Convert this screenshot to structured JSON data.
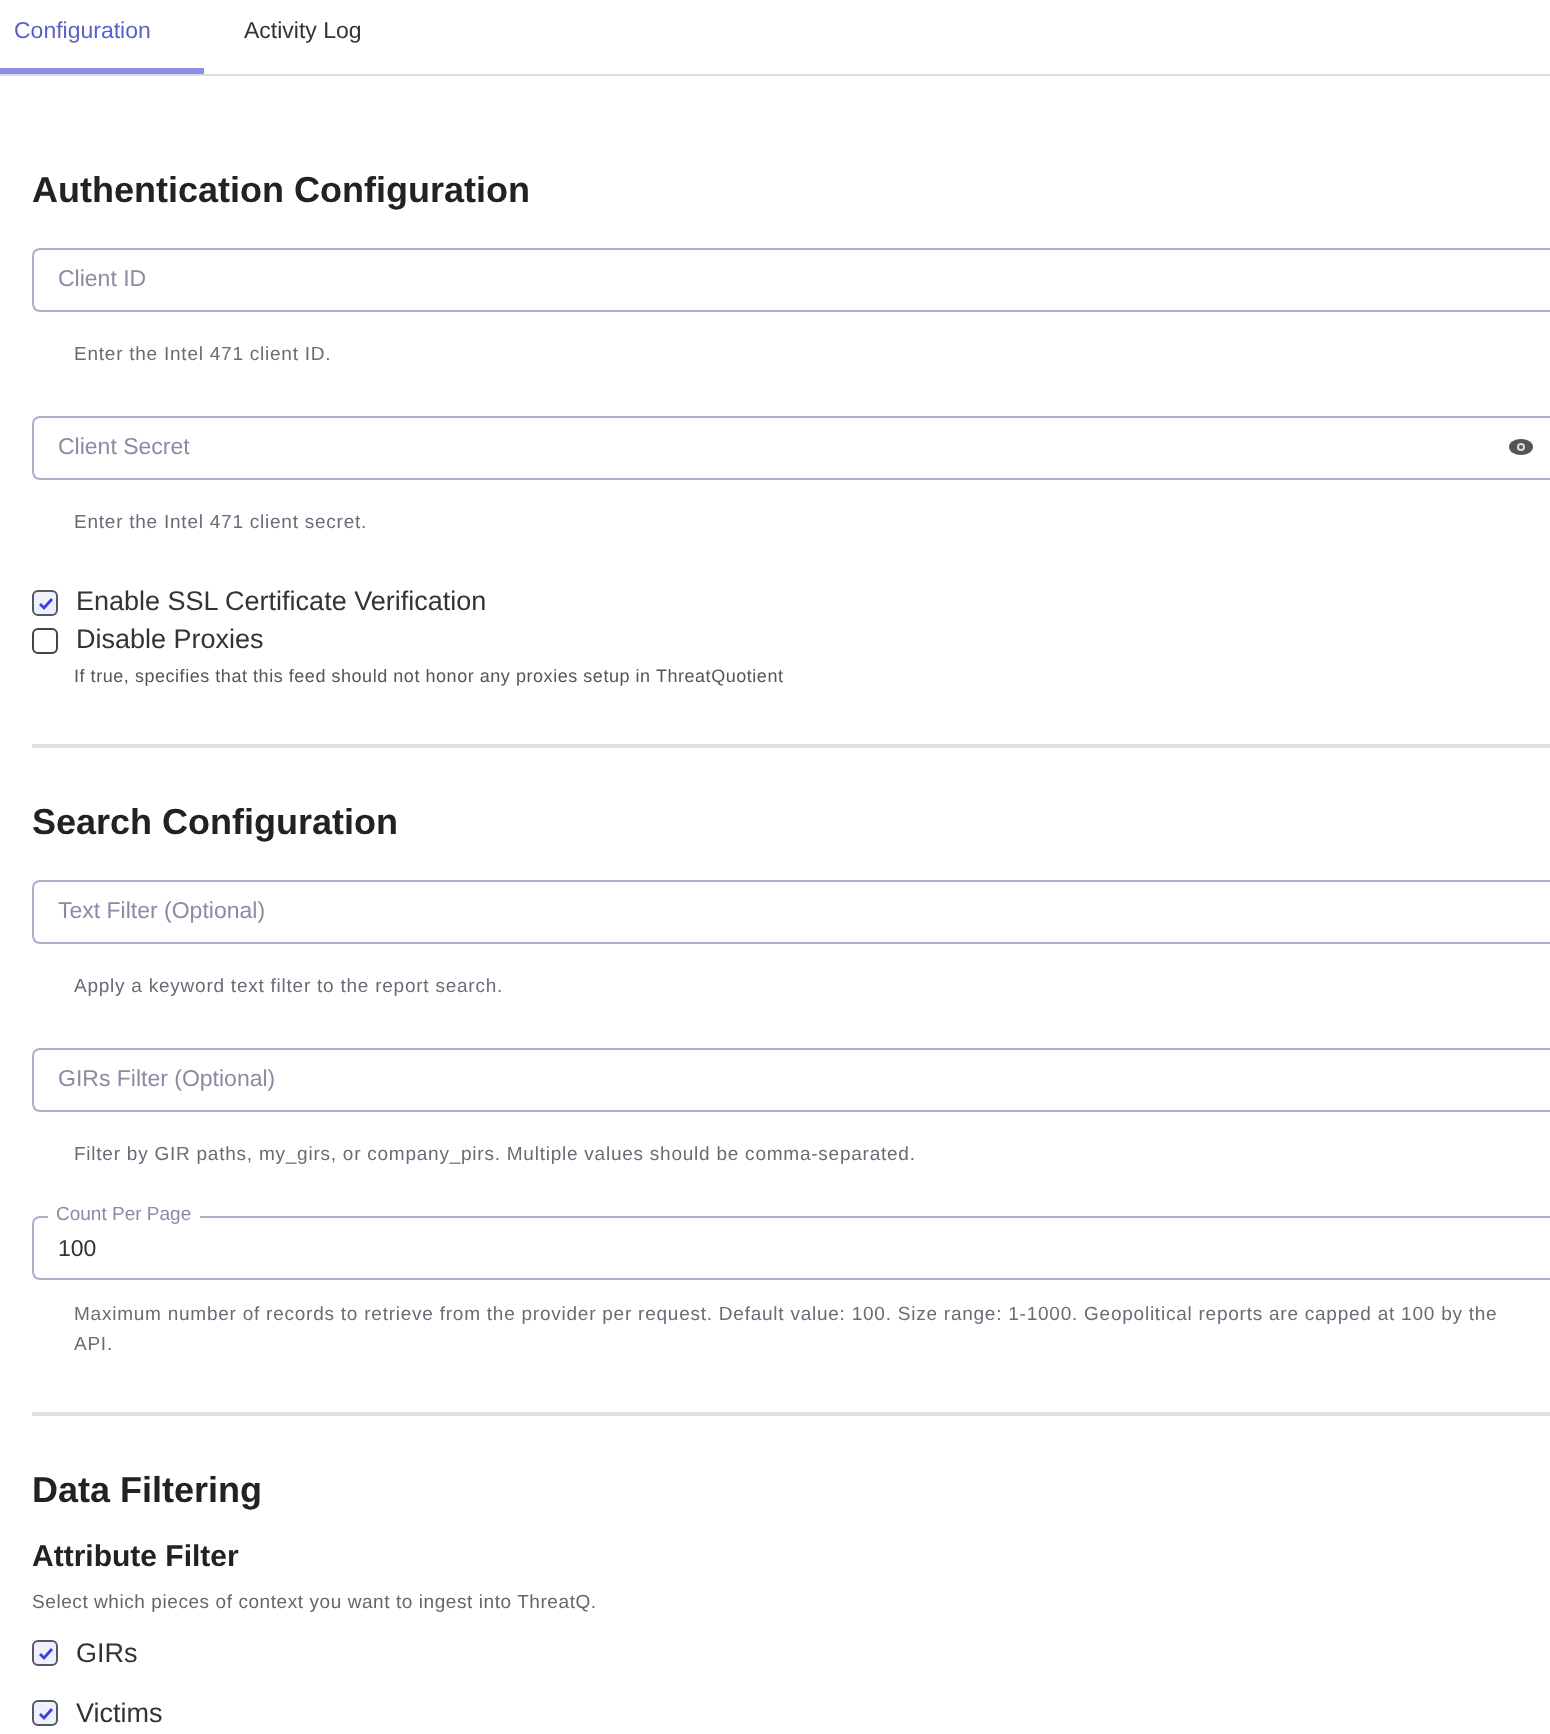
{
  "tabs": [
    {
      "label": "Configuration",
      "selected": true
    },
    {
      "label": "Activity Log",
      "selected": false
    }
  ],
  "sections": [
    {
      "title": "Authentication Configuration",
      "items": [
        {
          "kind": "field",
          "placeholder": "Client ID",
          "help": "Enter the Intel 471 client ID."
        },
        {
          "kind": "secret",
          "placeholder": "Client Secret",
          "help": "Enter the Intel 471 client secret."
        },
        {
          "kind": "checkbox",
          "label": "Enable SSL Certificate Verification",
          "checked": true
        },
        {
          "kind": "checkbox",
          "label": "Disable Proxies",
          "checked": false,
          "help": "If true, specifies that this feed should not honor any proxies setup in ThreatQuotient"
        }
      ]
    },
    {
      "title": "Search Configuration",
      "items": [
        {
          "kind": "field",
          "placeholder": "Text Filter (Optional)",
          "help": "Apply a keyword text filter to the report search."
        },
        {
          "kind": "field",
          "placeholder": "GIRs Filter (Optional)",
          "help": "Filter by GIR paths, my_girs, or company_pirs. Multiple values should be comma-separated."
        },
        {
          "kind": "valuefield",
          "label": "Count Per Page",
          "value": "100",
          "help": "Maximum number of records to retrieve from the provider per request. Default value: 100. Size range: 1-1000. Geopolitical reports are capped at 100 by the API."
        }
      ]
    },
    {
      "title": "Data Filtering",
      "items": [
        {
          "kind": "subheading",
          "label": "Attribute Filter"
        },
        {
          "kind": "description",
          "label": "Select which pieces of context you want to ingest into ThreatQ."
        },
        {
          "kind": "checklist",
          "options": [
            {
              "label": "GIRs",
              "checked": true
            },
            {
              "label": "Victims",
              "checked": true
            }
          ]
        }
      ]
    }
  ]
}
